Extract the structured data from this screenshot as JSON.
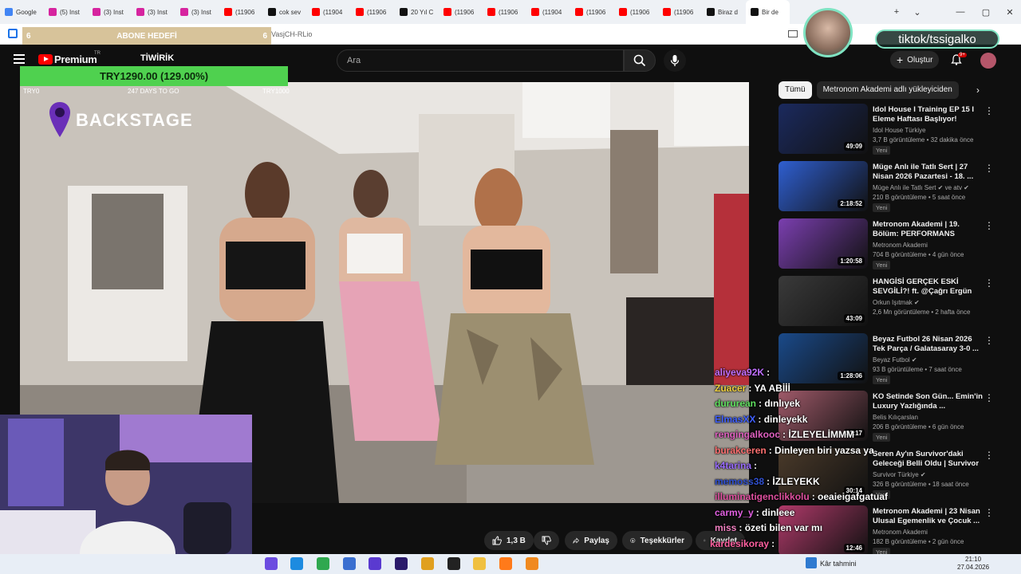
{
  "browser": {
    "tabs": [
      {
        "label": "Google",
        "color": "#4285f4"
      },
      {
        "label": "(5) Inst",
        "color": "#d6249f"
      },
      {
        "label": "(3) Inst",
        "color": "#d6249f"
      },
      {
        "label": "(3) Inst",
        "color": "#d6249f"
      },
      {
        "label": "(3) Inst",
        "color": "#d6249f"
      },
      {
        "label": "(11906",
        "color": "#ff0000"
      },
      {
        "label": "cok sev",
        "color": "#111111"
      },
      {
        "label": "(11904",
        "color": "#ff0000"
      },
      {
        "label": "(11906",
        "color": "#ff0000"
      },
      {
        "label": "20 Yıl C",
        "color": "#111111"
      },
      {
        "label": "(11906",
        "color": "#ff0000"
      },
      {
        "label": "(11906",
        "color": "#ff0000"
      },
      {
        "label": "(11904",
        "color": "#ff0000"
      },
      {
        "label": "(11906",
        "color": "#ff0000"
      },
      {
        "label": "(11906",
        "color": "#ff0000"
      },
      {
        "label": "(11906",
        "color": "#ff0000"
      },
      {
        "label": "Biraz d",
        "color": "#111111"
      },
      {
        "label": "Bir de",
        "color": "#111111"
      }
    ],
    "url_fragment": "VasjCH-RLio",
    "window_controls": {
      "minimize": "—",
      "maximize": "▢",
      "close": "✕",
      "new_tab": "+",
      "list": "⌄"
    }
  },
  "overlay": {
    "goal": {
      "left": "6",
      "title": "ABONE HEDEFİ",
      "right": "6"
    },
    "donation": {
      "amount": "TRY1290.00 (129.00%)",
      "start": "TRY0",
      "days": "247 DAYS TO GO",
      "target": "TRY1000"
    },
    "tiktok": "tiktok/tssigalko"
  },
  "youtube": {
    "logo": "Premium",
    "logo_sup": "TR",
    "channel_tag": "TİWİRİK",
    "search_placeholder": "Ara",
    "create_label": "Oluştur",
    "notif_badge": "9+",
    "video_overlay_text": "BACKSTAGE",
    "actions": {
      "likes": "1,3 B",
      "share": "Paylaş",
      "thanks": "Teşekkürler",
      "save": "Kaydet"
    },
    "chips": [
      "Tümü",
      "Metronom Akademi adlı yükleyiciden"
    ],
    "recommendations": [
      {
        "title": "Idol House I Training EP 15 I Eleme Haftası Başlıyor!",
        "channel": "Idol House Türkiye",
        "meta": "3,7 B görüntüleme • 32 dakika önce",
        "duration": "49:09",
        "badge": "Yeni",
        "thumb": "#1b2a5e",
        "verified": false
      },
      {
        "title": "Müge Anlı ile Tatlı Sert | 27 Nisan 2026 Pazartesi - 18. ...",
        "channel": "Müge Anlı ile Tatlı Sert ✔ ve atv ✔",
        "meta": "210 B görüntüleme • 5 saat önce",
        "duration": "2:18:52",
        "badge": "Yeni",
        "thumb": "#2f5fd1",
        "verified": true
      },
      {
        "title": "Metronom Akademi | 19. Bölüm: PERFORMANS ZAMANI",
        "channel": "Metronom Akademi",
        "meta": "704 B görüntüleme • 4 gün önce",
        "duration": "1:20:58",
        "badge": "Yeni",
        "thumb": "#7b3fb0",
        "verified": false
      },
      {
        "title": "HANGİSİ GERÇEK ESKİ SEVGİLİ?! ft. @Çağrı Ergün",
        "channel": "Orkun Işıtmak ✔",
        "meta": "2,6 Mn görüntüleme • 2 hafta önce",
        "duration": "43:09",
        "badge": "",
        "thumb": "#3a3a3a",
        "verified": true
      },
      {
        "title": "Beyaz Futbol 26 Nisan 2026 Tek Parça / Galatasaray 3-0 ...",
        "channel": "Beyaz Futbol ✔",
        "meta": "93 B görüntüleme • 7 saat önce",
        "duration": "1:28:06",
        "badge": "Yeni",
        "thumb": "#1a4a8a",
        "verified": true
      },
      {
        "title": "KO Setinde Son Gün... Emin'in Luxury Yazlığında ...",
        "channel": "Belis Kılıçarslan",
        "meta": "206 B görüntüleme • 6 gün önce",
        "duration": "31:17",
        "badge": "Yeni",
        "thumb": "#a05a6a",
        "verified": false
      },
      {
        "title": "Seren Ay'ın Survivor'daki Geleceği Belli Oldu | Survivor ...",
        "channel": "Survivor Türkiye ✔",
        "meta": "326 B görüntüleme • 18 saat önce",
        "duration": "30:14",
        "badge": "Yeni",
        "thumb": "#4a3a2a",
        "verified": true
      },
      {
        "title": "Metronom Akademi | 23 Nisan Ulusal Egemenlik ve Çocuk ...",
        "channel": "Metronom Akademi",
        "meta": "182 B görüntüleme • 2 gün önce",
        "duration": "12:46",
        "badge": "Yeni",
        "thumb": "#b03a6a",
        "verified": false
      }
    ]
  },
  "chat": [
    {
      "user": "aliyeva92K",
      "msg": ":",
      "color": "#c070ff"
    },
    {
      "user": "Zuacer",
      "msg": ": YA ABİİİ",
      "color": "#f0d040"
    },
    {
      "user": "dururean",
      "msg": ": dınlıyek",
      "color": "#60e060"
    },
    {
      "user": "ElmasXX",
      "msg": ": dinleyekk",
      "color": "#4060ff"
    },
    {
      "user": "rengingalkooc",
      "msg": ": İZLEYELİMMM",
      "color": "#e060c0"
    },
    {
      "user": "burakceren",
      "msg": ": Dinleyen biri yazsa ya",
      "color": "#ff7070"
    },
    {
      "user": "k4tarina",
      "msg": ":",
      "color": "#9a6cff"
    },
    {
      "user": "memoss38",
      "msg": ": İZLEYEKK",
      "color": "#3050d0"
    },
    {
      "user": "illuminatigenclikkolu",
      "msg": ": oeaieigafgatuaf",
      "color": "#e050a0"
    },
    {
      "user": "carmy_y",
      "msg": ": dinleee",
      "color": "#e060e0"
    },
    {
      "user": "miss",
      "msg": ": özeti bilen var mı",
      "color": "#f080c0"
    },
    {
      "user": "kardesikoray",
      "msg": ":",
      "color": "#ff60a0"
    }
  ],
  "taskbar": {
    "weather": "Kâr tahmini",
    "time": "21:10",
    "date": "27.04.2026"
  }
}
